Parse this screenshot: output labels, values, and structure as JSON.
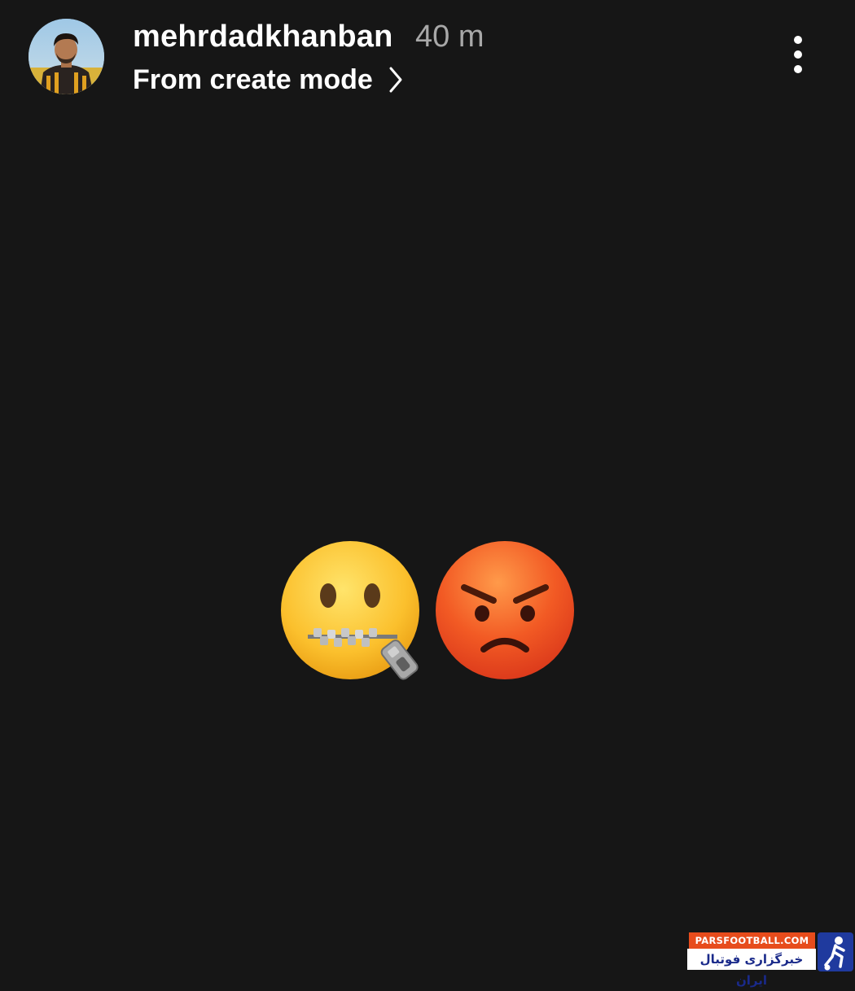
{
  "header": {
    "username": "mehrdadkhanban",
    "time_ago": "40 m",
    "subtitle": "From create mode",
    "icons": {
      "avatar": "profile-photo",
      "chevron": "chevron-right-icon",
      "more": "more-vertical-icon"
    }
  },
  "content": {
    "stickers": [
      "zipper-mouth-face",
      "angry-face"
    ]
  },
  "watermark": {
    "top_text": "PARSFOOTBALL.COM",
    "bottom_text": "خبرگزاری فوتبال ایران"
  },
  "colors": {
    "background": "#161616",
    "text_primary": "#ffffff",
    "text_secondary": "#a8a8a8",
    "watermark_orange": "#e74c1c",
    "watermark_blue": "#1f3a9e"
  }
}
